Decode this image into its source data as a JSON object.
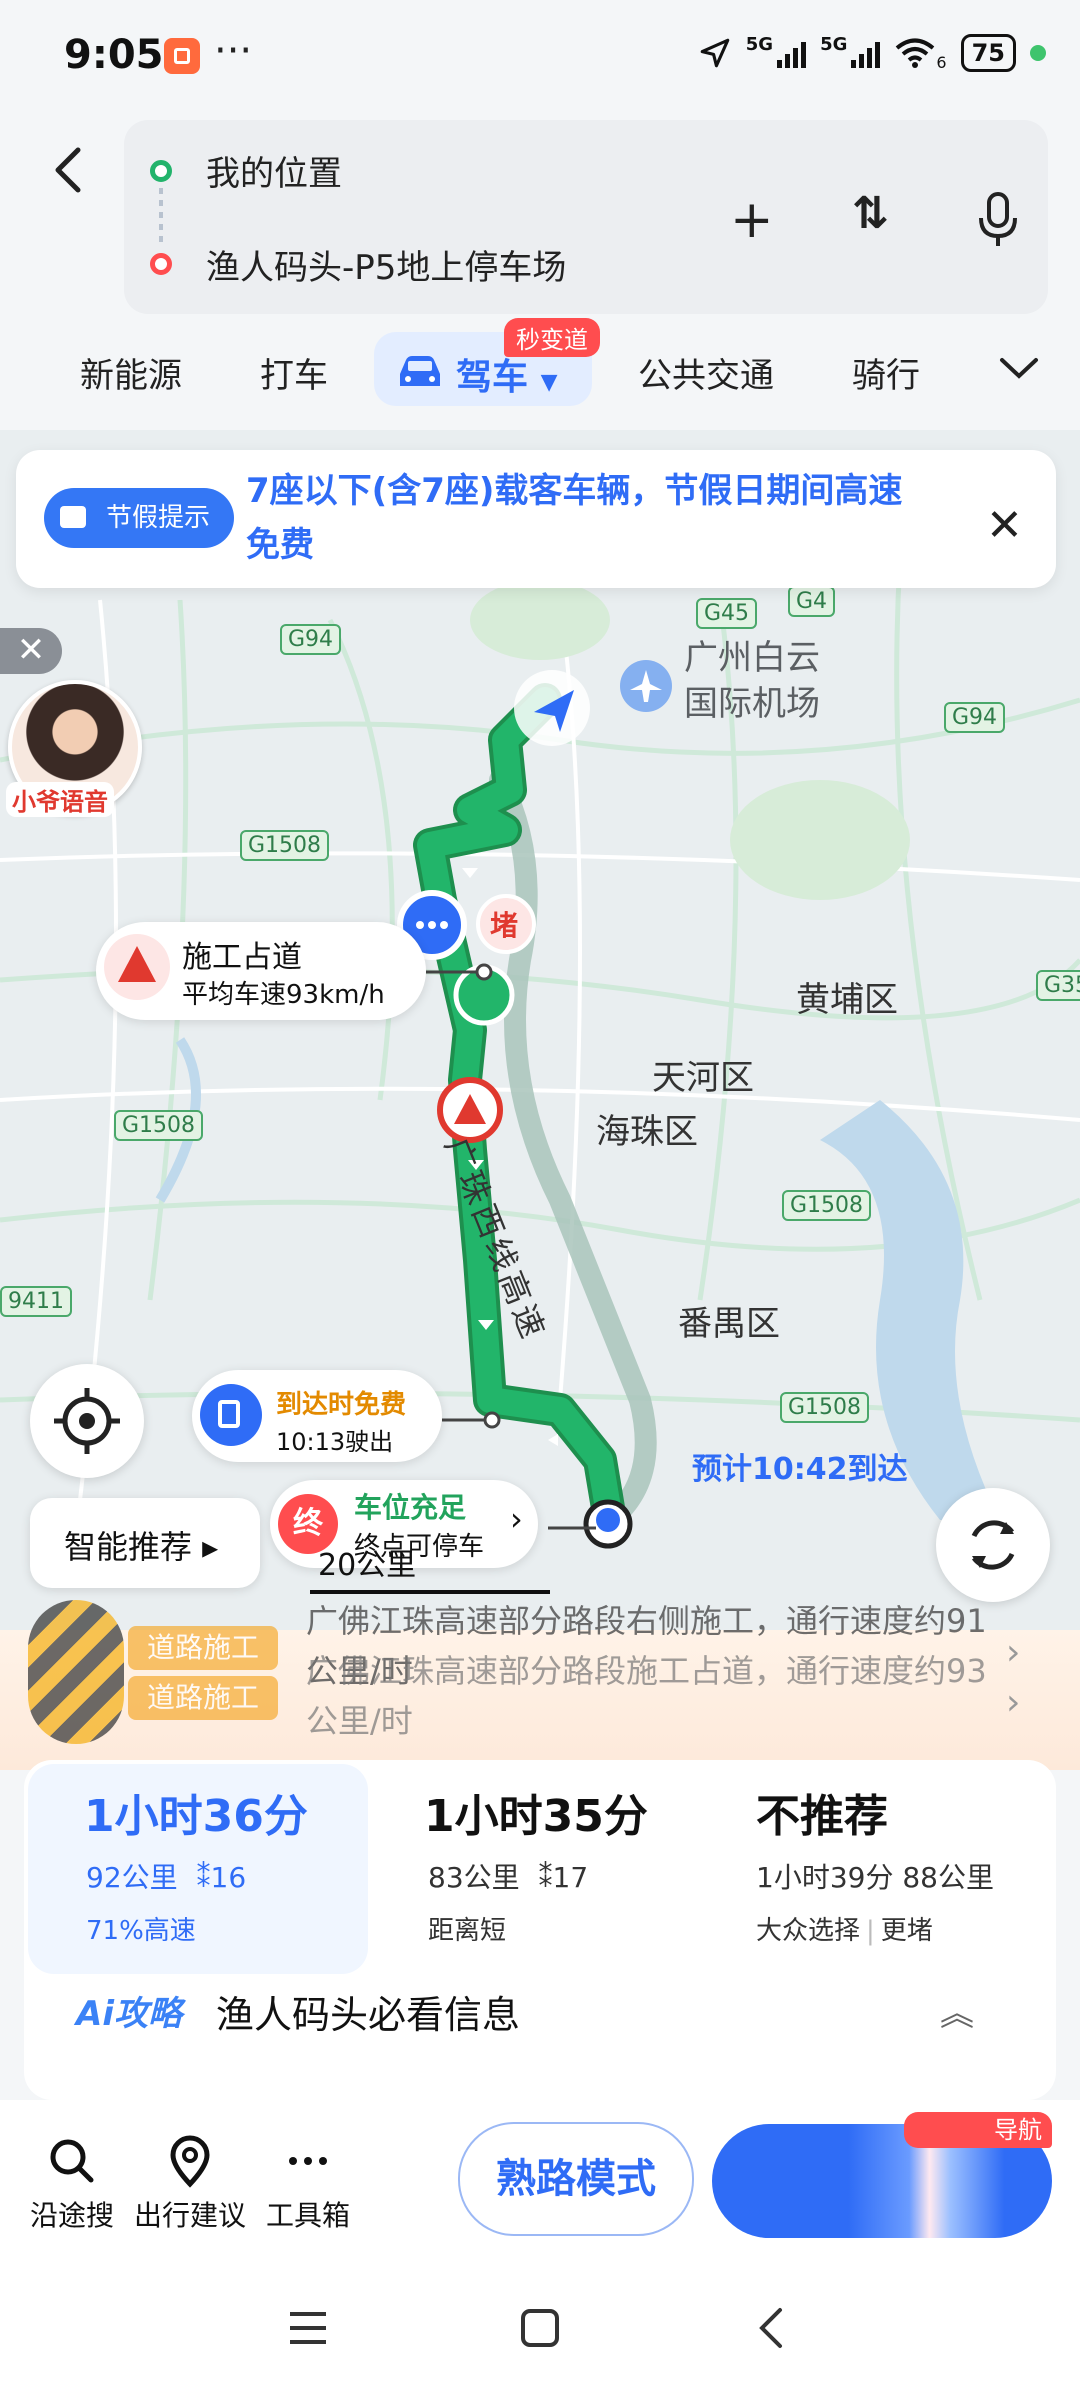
{
  "status_bar": {
    "time": "9:05",
    "more": "···",
    "net1": "5G",
    "net2": "5G",
    "wifi_sub": "6",
    "battery": "75"
  },
  "route_inputs": {
    "origin": "我的位置",
    "destination": "渔人码头-P5地上停车场",
    "add_icon": "plus-icon",
    "swap_icon": "swap-icon",
    "mic_icon": "microphone-icon"
  },
  "mode_tabs": {
    "items": [
      "新能源",
      "打车",
      "驾车",
      "公共交通",
      "骑行"
    ],
    "selected": "驾车",
    "lane_badge": "秒变道"
  },
  "holiday_tip": {
    "tag": "节假提示",
    "text": "7座以下(含7座)载客车辆，节假日期间高速免费"
  },
  "map": {
    "districts": [
      "广州白云",
      "国际机场",
      "黄埔区",
      "天河区",
      "海珠区",
      "番禺区"
    ],
    "route_name": "广珠西线高速",
    "highways": [
      "G94",
      "G45",
      "G4",
      "G94",
      "G1508",
      "G35",
      "G1508",
      "G1508",
      "G1508",
      "9411"
    ],
    "voice_label": "小爷语音",
    "congestion": "堵",
    "construction": {
      "title": "施工占道",
      "subtitle": "平均车速93km/h"
    },
    "toll_free": {
      "title": "到达时免费",
      "subtitle": "10:13驶出"
    },
    "eta": "预计10:42到达",
    "parking": {
      "icon_text": "终",
      "title": "车位充足",
      "subtitle": "终点可停车"
    },
    "smart_recommend": "智能推荐 ▸",
    "scale": "20公里"
  },
  "notices": {
    "tag": "道路施工",
    "line1": "广佛江珠高速部分路段右侧施工，通行速度约91公里/时",
    "line2": "广佛江珠高速部分路段施工占道，通行速度约93公里/时"
  },
  "routes": [
    {
      "time": "1小时36分",
      "distance": "92公里",
      "lights": "16",
      "note": "71%高速",
      "selected": true
    },
    {
      "time": "1小时35分",
      "distance": "83公里",
      "lights": "17",
      "note": "距离短",
      "selected": false
    },
    {
      "time": "不推荐",
      "detail": "1小时39分 88公里",
      "note1": "大众选择",
      "note2": "更堵",
      "selected": false
    }
  ],
  "ai_guide": {
    "logo": "Ai攻略",
    "text": "渔人码头必看信息"
  },
  "bottom_actions": {
    "along_search": "沿途搜",
    "trip_advice": "出行建议",
    "toolbox": "工具箱",
    "familiar_mode": "熟路模式",
    "start_badge": "导航"
  },
  "colors": {
    "accent": "#2f6cf6",
    "route": "#1fae5c",
    "alt_route": "#9dbbb0",
    "warning": "#e0392f"
  }
}
